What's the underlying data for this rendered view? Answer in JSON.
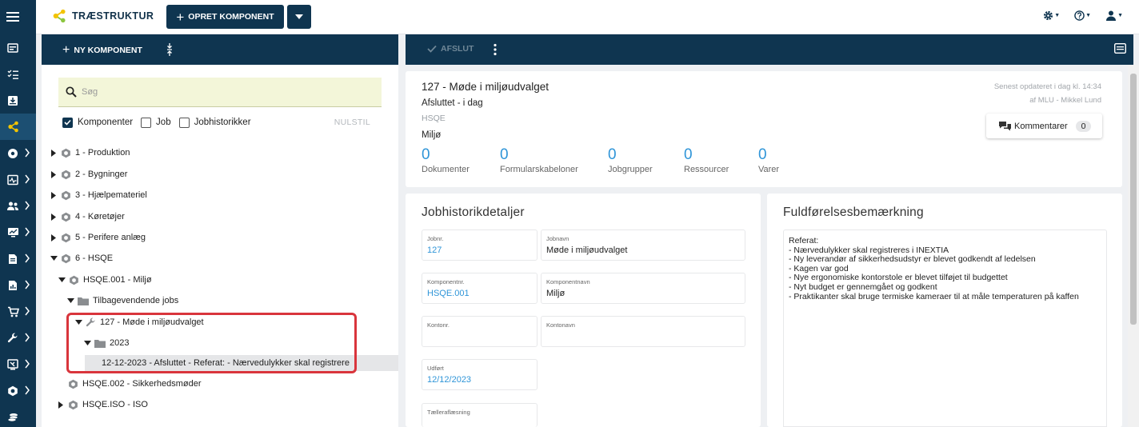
{
  "colors": {
    "navy": "#0f3550",
    "accent": "#2f95d8",
    "highlight": "#d9353c",
    "search_bg": "#f3f6d9",
    "brand_green": "#f2c300"
  },
  "app": {
    "title": "TRÆSTRUKTUR",
    "create_label": "OPRET KOMPONENT"
  },
  "rail": {
    "items": [
      {
        "icon": "menu-icon"
      },
      {
        "icon": "dashboard-icon"
      },
      {
        "icon": "checklist-icon"
      },
      {
        "icon": "inbox-icon"
      },
      {
        "icon": "tree-structure-icon"
      },
      {
        "icon": "settings-document-icon"
      },
      {
        "icon": "monitor-icon"
      },
      {
        "icon": "users-icon"
      },
      {
        "icon": "chart-icon"
      },
      {
        "icon": "document-icon"
      },
      {
        "icon": "report-icon"
      },
      {
        "icon": "cart-icon"
      },
      {
        "icon": "wrench-icon"
      },
      {
        "icon": "tools-icon"
      },
      {
        "icon": "component-icon"
      },
      {
        "icon": "coins-icon"
      }
    ]
  },
  "left_panel": {
    "new_label": "NY KOMPONENT",
    "search_placeholder": "Søg",
    "filters": [
      {
        "label": "Komponenter",
        "checked": true
      },
      {
        "label": "Job",
        "checked": false
      },
      {
        "label": "Jobhistorikker",
        "checked": false
      }
    ],
    "reset_label": "NULSTIL",
    "tree": [
      {
        "label": "1 - Produktion"
      },
      {
        "label": "2 - Bygninger"
      },
      {
        "label": "3 - Hjælpemateriel"
      },
      {
        "label": "4 - Køretøjer"
      },
      {
        "label": "5 - Perifere anlæg"
      },
      {
        "label": "6 - HSQE"
      },
      {
        "label": "HSQE.001 - Miljø"
      },
      {
        "label": "Tilbagevendende jobs"
      },
      {
        "label": "127 - Møde i miljøudvalget"
      },
      {
        "label": "2023"
      },
      {
        "label": "12-12-2023 - Afsluttet - Referat: - Nærvedulykker skal registrere"
      },
      {
        "label": "HSQE.002 - Sikkerhedsmøder"
      },
      {
        "label": "HSQE.ISO - ISO"
      }
    ]
  },
  "right_panel": {
    "finish_label": "AFSLUT",
    "summary": {
      "title": "127 - Møde i miljøudvalget",
      "status": "Afsluttet - i dag",
      "code": "HSQE",
      "name": "Miljø",
      "updated_line1": "Senest opdateret i dag kl. 14:34",
      "updated_line2": "af MLU - Mikkel Lund",
      "comments_label": "Kommentarer",
      "comments_count": "0",
      "stats": [
        {
          "value": "0",
          "label": "Dokumenter"
        },
        {
          "value": "0",
          "label": "Formularskabeloner"
        },
        {
          "value": "0",
          "label": "Jobgrupper"
        },
        {
          "value": "0",
          "label": "Ressourcer"
        },
        {
          "value": "0",
          "label": "Varer"
        }
      ]
    },
    "details": {
      "title": "Jobhistorikdetaljer",
      "fields": [
        {
          "label": "Jobnr.",
          "value": "127"
        },
        {
          "label": "Jobnavn",
          "value": "Møde i miljøudvalget"
        },
        {
          "label": "Komponentnr.",
          "value": "HSQE.001"
        },
        {
          "label": "Komponentnavn",
          "value": "Miljø"
        },
        {
          "label": "Kontonr.",
          "value": ""
        },
        {
          "label": "Kontonavn",
          "value": ""
        },
        {
          "label": "Udført",
          "value": "12/12/2023"
        },
        {
          "label": "Tælleraflæsning",
          "value": ""
        }
      ]
    },
    "remarks": {
      "title": "Fuldførelsesbemærkning",
      "lines": [
        "Referat:",
        "- Nærvedulykker skal registreres i INEXTIA",
        "- Ny leverandør af sikkerhedsudstyr er blevet godkendt af ledelsen",
        "- Kagen var god",
        "- Nye ergonomiske kontorstole er blevet tilføjet til budgettet",
        "- Nyt budget er gennemgået og godkent",
        "- Praktikanter skal bruge termiske kameraer til at måle temperaturen på kaffen"
      ]
    }
  }
}
